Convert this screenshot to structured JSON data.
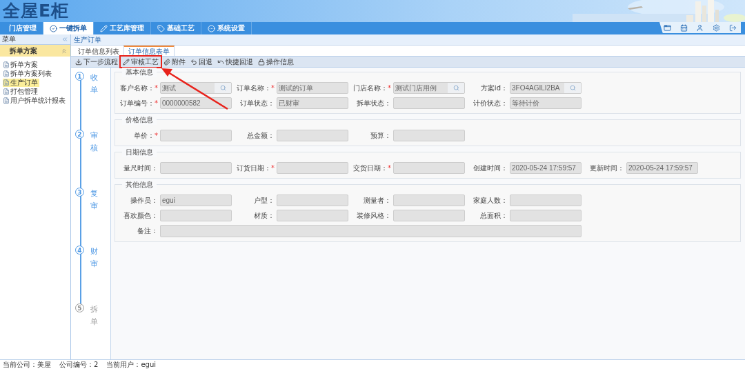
{
  "header": {
    "logo": "全屋E柜"
  },
  "nav": [
    {
      "label": "门店管理",
      "kind": "plain",
      "selected": false
    },
    {
      "label": "一键拆单",
      "kind": "check",
      "selected": true
    },
    {
      "label": "工艺库管理",
      "kind": "pen",
      "selected": false
    },
    {
      "label": "基础工艺",
      "kind": "tag",
      "selected": false
    },
    {
      "label": "系统设置",
      "kind": "dots",
      "selected": false
    }
  ],
  "sidebar": {
    "title": "菜单",
    "section": "拆单方案",
    "items": [
      {
        "label": "拆单方案",
        "selected": false
      },
      {
        "label": "拆单方案列表",
        "selected": false
      },
      {
        "label": "生产订单",
        "selected": true
      },
      {
        "label": "打包管理",
        "selected": false
      },
      {
        "label": "用户拆单统计报表",
        "selected": false
      }
    ]
  },
  "breadcrumb": "生产订单",
  "tabs": [
    {
      "label": "订单信息列表",
      "selected": false
    },
    {
      "label": "订单信息表单",
      "selected": true
    }
  ],
  "toolbar": [
    {
      "label": "下一步流程",
      "kind": "download",
      "highlighted": false
    },
    {
      "label": "审核工艺",
      "kind": "pencil",
      "highlighted": true
    },
    {
      "label": "附件",
      "kind": "attach",
      "highlighted": false
    },
    {
      "label": "回退",
      "kind": "back",
      "highlighted": false
    },
    {
      "label": "快捷回退",
      "kind": "fastback",
      "highlighted": false
    },
    {
      "label": "操作信息",
      "kind": "lock",
      "highlighted": false
    }
  ],
  "steps": [
    {
      "number": "1",
      "label": "收单",
      "done": true
    },
    {
      "number": "2",
      "label": "审核",
      "done": true
    },
    {
      "number": "3",
      "label": "复审",
      "done": true
    },
    {
      "number": "4",
      "label": "财审",
      "done": true
    },
    {
      "number": "5",
      "label": "拆单",
      "done": false
    }
  ],
  "sections": [
    {
      "title": "基本信息",
      "rows": [
        [
          {
            "label": "客户名称：",
            "mark": "*",
            "kind": "search",
            "value": "测试"
          },
          {
            "label": "订单名称：",
            "mark": "*",
            "kind": "text",
            "value": "测试的订单"
          },
          {
            "label": "门店名称：",
            "mark": "*",
            "kind": "search",
            "value": "测试门店用例"
          },
          {
            "label": "方案id：",
            "kind": "search",
            "value": "3FO4AGILI2BA"
          }
        ],
        [
          {
            "label": "订单编号：",
            "mark": "*",
            "kind": "text",
            "value": "0000000582"
          },
          {
            "label": "订单状态：",
            "kind": "text",
            "value": "已财审"
          },
          {
            "label": "拆单状态：",
            "kind": "text"
          },
          {
            "label": "计价状态：",
            "kind": "text",
            "value": "等待计价"
          }
        ]
      ]
    },
    {
      "title": "价格信息",
      "rows": [
        [
          {
            "label": "单价：",
            "mark": "*",
            "kind": "text"
          },
          {
            "label": "总金额：",
            "kind": "text"
          },
          {
            "label": "预算：",
            "kind": "text"
          }
        ]
      ]
    },
    {
      "title": "日期信息",
      "rows": [
        [
          {
            "label": "量尺时间：",
            "kind": "text"
          },
          {
            "label": "订货日期：",
            "mark": "*",
            "kind": "text"
          },
          {
            "label": "交货日期：",
            "mark": "*",
            "kind": "text"
          },
          {
            "label": "创建时间：",
            "kind": "text",
            "value": "2020-05-24 17:59:57"
          },
          {
            "label": "更新时间：",
            "kind": "text",
            "value": "2020-05-24 17:59:57"
          }
        ]
      ]
    },
    {
      "title": "其他信息",
      "rows": [
        [
          {
            "label": "操作员：",
            "kind": "text",
            "value": "egui"
          },
          {
            "label": "户型：",
            "kind": "text"
          },
          {
            "label": "测量者：",
            "kind": "text"
          },
          {
            "label": "家庭人数：",
            "kind": "text"
          }
        ],
        [
          {
            "label": "喜欢颜色：",
            "kind": "text"
          },
          {
            "label": "材质：",
            "kind": "text"
          },
          {
            "label": "装修风格：",
            "kind": "text"
          },
          {
            "label": "总面积：",
            "kind": "text"
          }
        ],
        [
          {
            "label": "备注：",
            "kind": "textarea"
          }
        ]
      ]
    }
  ],
  "status_bar": [
    "当前公司：美屋",
    "公司编号：2",
    "当前用户：egui"
  ]
}
